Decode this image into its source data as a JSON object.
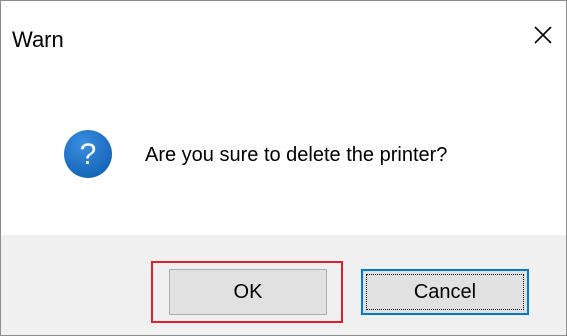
{
  "dialog": {
    "title": "Warn",
    "close_icon": "close-icon",
    "icon": "question-icon",
    "icon_color": "#1f6fbf",
    "message": "Are you sure to delete the printer?",
    "buttons": {
      "ok_label": "OK",
      "cancel_label": "Cancel"
    },
    "highlight_color": "#e0202a",
    "focused_button": "Cancel"
  }
}
